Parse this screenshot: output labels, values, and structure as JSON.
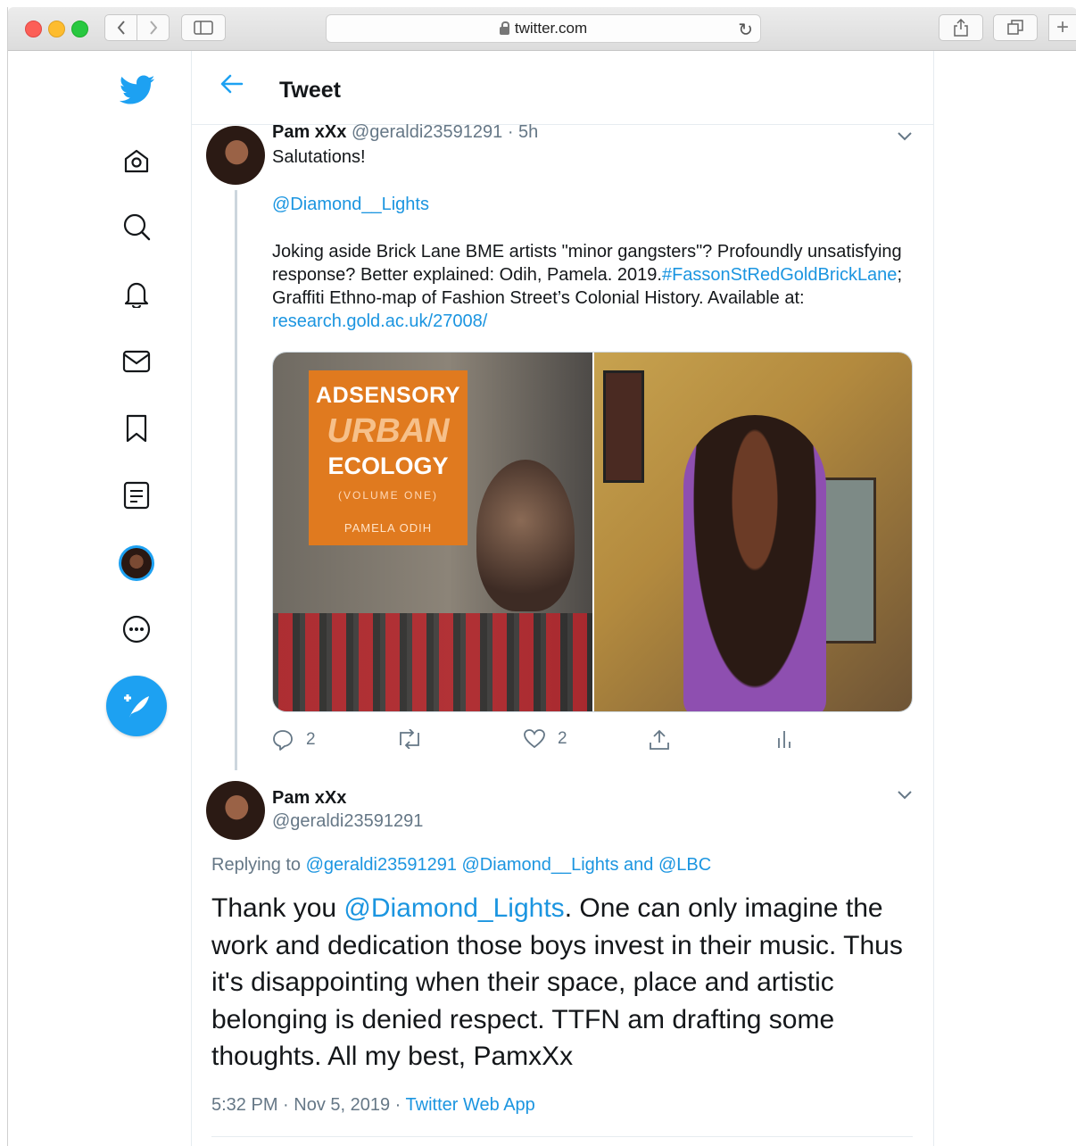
{
  "browser": {
    "url": "twitter.com"
  },
  "header": {
    "title": "Tweet"
  },
  "tweet1": {
    "name": "Pam xXx",
    "handle_time": "@geraldi23591291 · 5h",
    "line1": "Salutations!",
    "mention": "@Diamond__Lights",
    "text_a": "Joking aside Brick Lane BME artists \"minor gangsters\"? Profoundly unsatisfying response? Better explained: Odih, Pamela. 2019.",
    "hashtag": "#FassonStRedGoldBrickLane",
    "text_b": "; Graffiti Ethno-map of Fashion Street’s Colonial History. Available at: ",
    "link": "research.gold.ac.uk/27008/",
    "book": {
      "line1": "ADSENSORY",
      "line2": "URBAN",
      "line3": "ECOLOGY",
      "line4": "(VOLUME ONE)",
      "author": "PAMELA ODIH"
    },
    "actions": {
      "replies": "2",
      "likes": "2"
    }
  },
  "tweet2": {
    "name": "Pam xXx",
    "handle": "@geraldi23591291",
    "replying_prefix": "Replying to ",
    "replying_to": "@geraldi23591291 @Diamond__Lights and @LBC",
    "body_prefix": "Thank you ",
    "body_mention": "@Diamond_Lights",
    "body_rest": ". One can only imagine the work and dedication those boys invest in their music. Thus it's disappointing when their space, place and artistic belonging is denied respect. TTFN am drafting some thoughts. All my best, PamxXx",
    "time": "5:32 PM · Nov 5, 2019 · ",
    "source": "Twitter Web App"
  },
  "colors": {
    "accent": "#1da1f2",
    "link": "#1b95e0",
    "muted": "#657786"
  },
  "icons": [
    "twitter-logo-icon",
    "home-icon",
    "explore-icon",
    "notifications-icon",
    "messages-icon",
    "bookmarks-icon",
    "lists-icon",
    "profile-avatar",
    "more-icon",
    "compose-tweet-icon"
  ]
}
